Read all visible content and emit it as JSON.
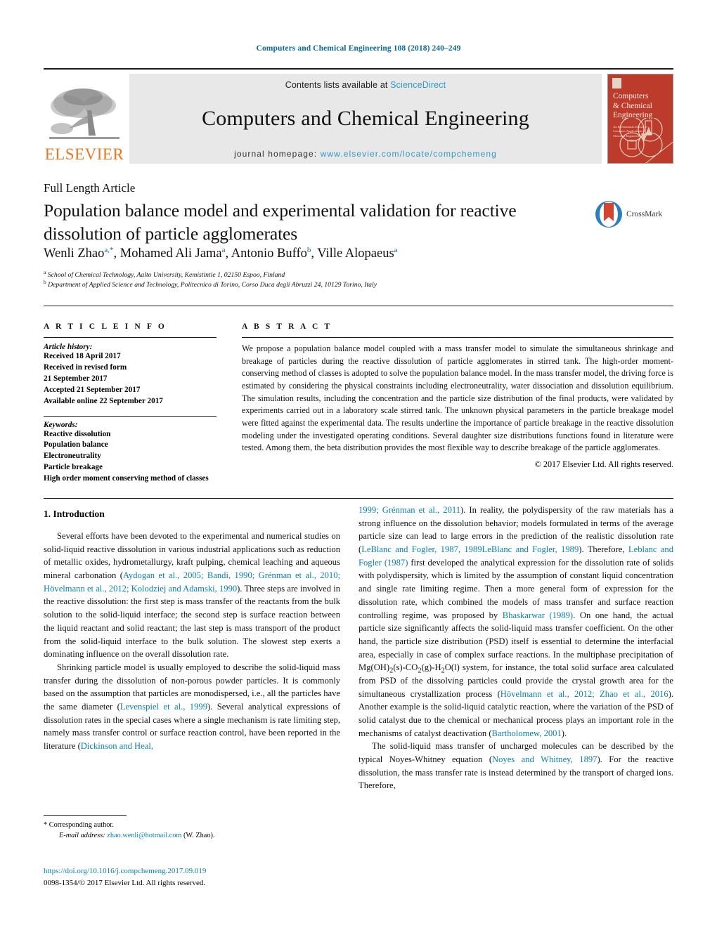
{
  "running_head": "Computers and Chemical Engineering 108 (2018) 240–249",
  "colors": {
    "link": "#0b7fad",
    "running_head": "#0b6a96",
    "elsevier_orange": "#E87722",
    "sciencedirect": "#2f99c9",
    "band_gray": "#e8e8e8",
    "cover_red": "#bd3b2b"
  },
  "masthead": {
    "publisher_name": "ELSEVIER",
    "contents_prefix": "Contents lists available at ",
    "contents_link": "ScienceDirect",
    "journal_title": "Computers and Chemical Engineering",
    "homepage_prefix": "journal homepage: ",
    "homepage_url": "www.elsevier.com/locate/compchemeng",
    "cover": {
      "title_line1": "Computers",
      "title_line2": "& Chemical",
      "title_line3": "Engineering",
      "subtitle": "An International Journal of Computer Applications in Chemical Engineering"
    }
  },
  "article": {
    "type": "Full Length Article",
    "title": "Population balance model and experimental validation for reactive dissolution of particle agglomerates",
    "crossmark_label": "CrossMark",
    "authors_html": "Wenli Zhao<sup>a,*</sup>, Mohamed Ali Jama<sup>a</sup>, Antonio Buffo<sup>b</sup>, Ville Alopaeus<sup>a</sup>",
    "affiliations": [
      {
        "marker": "a",
        "text": "School of Chemical Technology, Aalto University, Kemistintie 1, 02150 Espoo, Finland"
      },
      {
        "marker": "b",
        "text": "Department of Applied Science and Technology, Politecnico di Torino, Corso Duca degli Abruzzi 24, 10129 Torino, Italy"
      }
    ]
  },
  "info": {
    "heading": "A R T I C L E   I N F O",
    "history_label": "Article history:",
    "history": [
      "Received 18 April 2017",
      "Received in revised form",
      "21 September 2017",
      "Accepted 21 September 2017",
      "Available online 22 September 2017"
    ],
    "keywords_label": "Keywords:",
    "keywords": [
      "Reactive dissolution",
      "Population balance",
      "Electroneutrality",
      "Particle breakage",
      "High order moment conserving method of classes"
    ]
  },
  "abstract": {
    "heading": "A B S T R A C T",
    "text": "We propose a population balance model coupled with a mass transfer model to simulate the simultaneous shrinkage and breakage of particles during the reactive dissolution of particle agglomerates in stirred tank. The high-order moment-conserving method of classes is adopted to solve the population balance model. In the mass transfer model, the driving force is estimated by considering the physical constraints including electroneutrality, water dissociation and dissolution equilibrium. The simulation results, including the concentration and the particle size distribution of the final products, were validated by experiments carried out in a laboratory scale stirred tank. The unknown physical parameters in the particle breakage model were fitted against the experimental data. The results underline the importance of particle breakage in the reactive dissolution modeling under the investigated operating conditions. Several daughter size distributions functions found in literature were tested. Among them, the beta distribution provides the most flexible way to describe breakage of the particle agglomerates.",
    "copyright": "© 2017 Elsevier Ltd. All rights reserved."
  },
  "body": {
    "section_number_title": "1.  Introduction",
    "left_paragraphs_html": [
      "Several efforts have been devoted to the experimental and numerical studies on solid-liquid reactive dissolution in various industrial applications such as reduction of metallic oxides, hydrometallurgy, kraft pulping, chemical leaching and aqueous mineral carbonation (<span class=\"lnk\">Aydogan et al., 2005; Bandi, 1990; Grénman et al., 2010; Hövelmann et al., 2012; Kolodziej and Adamski, 1990</span>). Three steps are involved in the reactive dissolution: the first step is mass transfer of the reactants from the bulk solution to the solid-liquid interface; the second step is surface reaction between the liquid reactant and solid reactant; the last step is mass transport of the product from the solid-liquid interface to the bulk solution. The slowest step exerts a dominating influence on the overall dissolution rate.",
      "Shrinking particle model is usually employed to describe the solid-liquid mass transfer during the dissolution of non-porous powder particles. It is commonly based on the assumption that particles are monodispersed, i.e., all the particles have the same diameter (<span class=\"lnk\">Levenspiel et al., 1999</span>). Several analytical expressions of dissolution rates in the special cases where a single mechanism is rate limiting step, namely mass transfer control or surface reaction control, have been reported in the literature (<span class=\"lnk\">Dickinson and Heal,</span>"
    ],
    "right_paragraphs_html": [
      "<span class=\"lnk\">1999; Grénman et al., 2011</span>). In reality, the polydispersity of the raw materials has a strong influence on the dissolution behavior; models formulated in terms of the average particle size can lead to large errors in the prediction of the realistic dissolution rate (<span class=\"lnk\">LeBlanc and Fogler, 1987, 1989LeBlanc and Fogler, 1989</span>). Therefore, <span class=\"lnk\">Leblanc and Fogler (1987)</span> first developed the analytical expression for the dissolution rate of solids with polydispersity, which is limited by the assumption of constant liquid concentration and single rate limiting regime. Then a more general form of expression for the dissolution rate, which combined the models of mass transfer and surface reaction controlling regime, was proposed by <span class=\"lnk\">Bhaskarwar (1989)</span>. On one hand, the actual particle size significantly affects the solid-liquid mass transfer coefficient. On the other hand, the particle size distribution (PSD) itself is essential to determine the interfacial area, especially in case of complex surface reactions. In the multiphase precipitation of Mg(OH)<sub>2</sub>(s)-CO<sub>2</sub>(g)-H<sub>2</sub>O(l) system, for instance, the total solid surface area calculated from PSD of the dissolving particles could provide the crystal growth area for the simultaneous crystallization process (<span class=\"lnk\">Hövelmann et al., 2012; Zhao et al., 2016</span>). Another example is the solid-liquid catalytic reaction, where the variation of the PSD of solid catalyst due to the chemical or mechanical process plays an important role in the mechanisms of catalyst deactivation (<span class=\"lnk\">Bartholomew, 2001</span>).",
      "The solid-liquid mass transfer of uncharged molecules can be described by the typical Noyes-Whitney equation (<span class=\"lnk\">Noyes and Whitney, 1897</span>). For the reactive dissolution, the mass transfer rate is instead determined by the transport of charged ions. Therefore,"
    ]
  },
  "footnote": {
    "corresponding_marker": "*",
    "corresponding_text": "Corresponding author.",
    "email_label": "E-mail address:",
    "email": "zhao.wenli@hotmail.com",
    "email_owner": "(W. Zhao)."
  },
  "doi_block": {
    "doi": "https://doi.org/10.1016/j.compchemeng.2017.09.019",
    "issn_line": "0098-1354/© 2017 Elsevier Ltd. All rights reserved."
  }
}
